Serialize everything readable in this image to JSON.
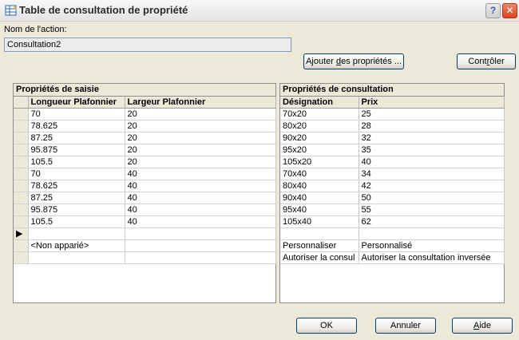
{
  "window": {
    "title": "Table de consultation de propriété",
    "help_symbol": "?",
    "close_symbol": "✕",
    "icon": "table-icon"
  },
  "action": {
    "label": "Nom de l'action:",
    "value": "Consultation2"
  },
  "buttons": {
    "add_props_pre": "Ajouter ",
    "add_props_u": "d",
    "add_props_post": "es propriétés ...",
    "check_pre": "Cont",
    "check_u": "r",
    "check_post": "ôler",
    "ok": "OK",
    "cancel": "Annuler",
    "help_u": "A",
    "help_post": "ide"
  },
  "input_panel": {
    "title": "Propriétés de saisie",
    "headers": [
      "Longueur Plafonnier",
      "Largeur Plafonnier"
    ],
    "rows": [
      [
        "70",
        "20"
      ],
      [
        "78.625",
        "20"
      ],
      [
        "87.25",
        "20"
      ],
      [
        "95.875",
        "20"
      ],
      [
        "105.5",
        "20"
      ],
      [
        "70",
        "40"
      ],
      [
        "78.625",
        "40"
      ],
      [
        "87.25",
        "40"
      ],
      [
        "95.875",
        "40"
      ],
      [
        "105.5",
        "40"
      ]
    ],
    "new_row_marker": "▶",
    "unmatched_label": "<Non apparié>"
  },
  "lookup_panel": {
    "title": "Propriétés de consultation",
    "headers": [
      "Désignation",
      "Prix"
    ],
    "rows": [
      [
        "70x20",
        "25"
      ],
      [
        "80x20",
        "28"
      ],
      [
        "90x20",
        "32"
      ],
      [
        "95x20",
        "35"
      ],
      [
        "105x20",
        "40"
      ],
      [
        "70x40",
        "34"
      ],
      [
        "80x40",
        "42"
      ],
      [
        "90x40",
        "50"
      ],
      [
        "95x40",
        "55"
      ],
      [
        "105x40",
        "62"
      ]
    ],
    "custom_row": [
      "Personnaliser",
      "Personnalisé"
    ],
    "reverse_row": [
      "Autoriser la consul",
      "Autoriser la consultation inversée"
    ]
  }
}
